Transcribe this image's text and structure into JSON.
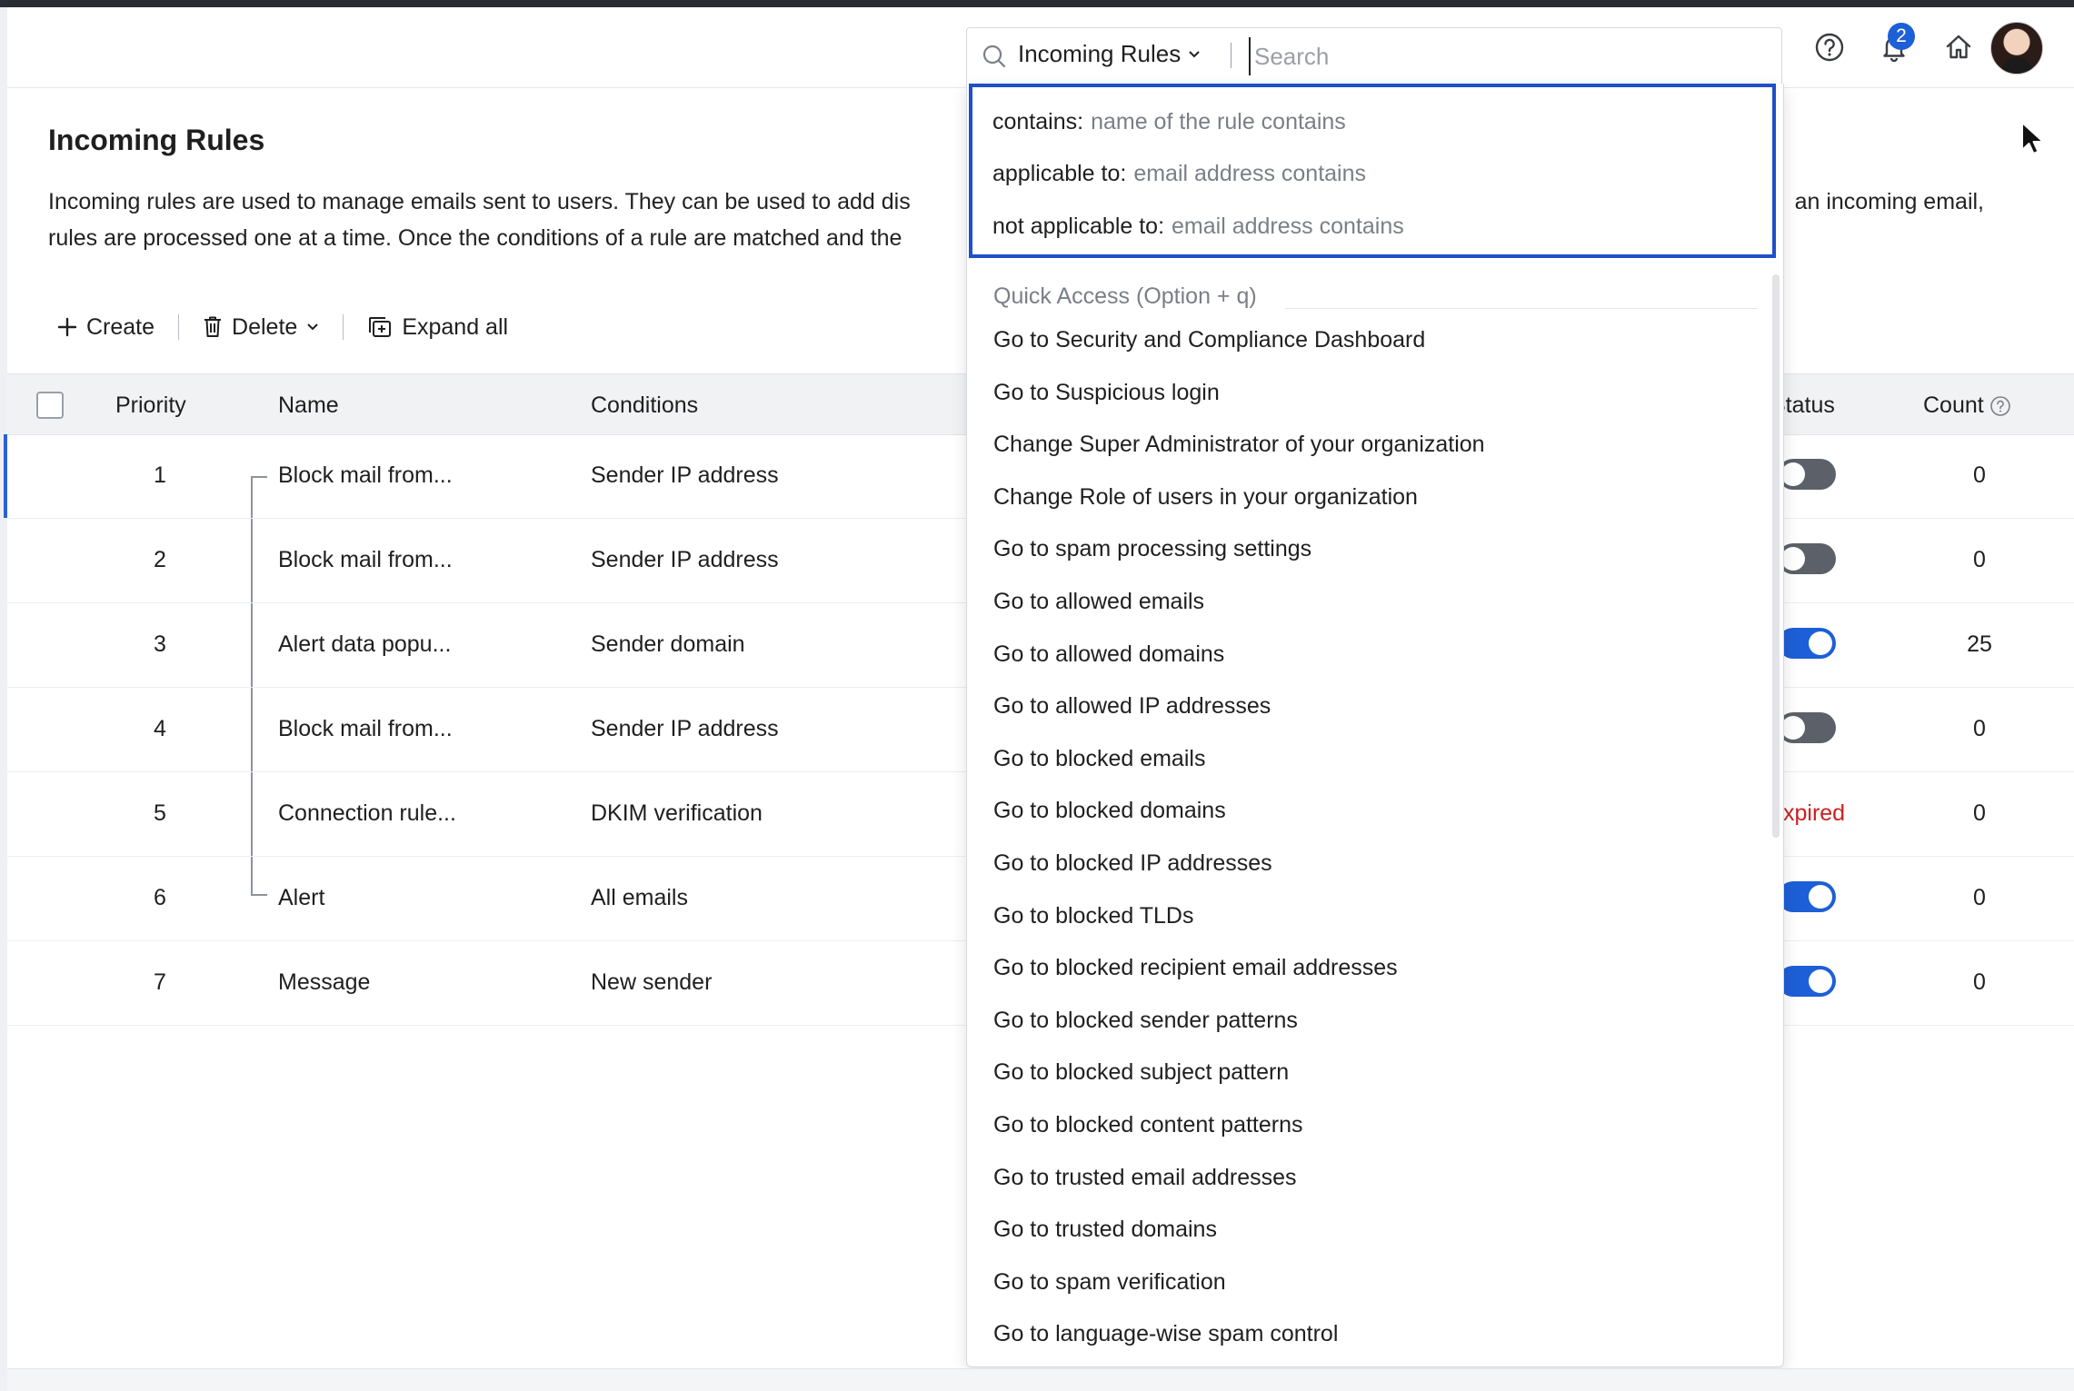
{
  "page": {
    "title": "Incoming Rules",
    "description": "Incoming rules are used to manage emails sent to users. They can be used to add dis… an incoming email, rules are processed one at a time. Once the conditions of a rule are matched and the…",
    "desc_line1_left": "Incoming rules are used to manage emails sent to users. They can be used to add dis",
    "desc_line1_right": "an incoming email,",
    "desc_line2_left": "rules are processed one at a time. Once the conditions of a rule are matched and the"
  },
  "toolbar": {
    "create_label": "Create",
    "delete_label": "Delete",
    "expand_label": "Expand all"
  },
  "table": {
    "columns": {
      "priority": "Priority",
      "name": "Name",
      "conditions": "Conditions",
      "status": "Status",
      "count": "Count"
    },
    "rows": [
      {
        "priority": "1",
        "name": "Block mail from...",
        "condition": "Sender IP address",
        "status": "off",
        "status_text": "",
        "count": "0"
      },
      {
        "priority": "2",
        "name": "Block mail from...",
        "condition": "Sender IP address",
        "status": "off",
        "status_text": "",
        "count": "0"
      },
      {
        "priority": "3",
        "name": "Alert data popu...",
        "condition": "Sender domain",
        "status": "on",
        "status_text": "",
        "count": "25"
      },
      {
        "priority": "4",
        "name": "Block mail from...",
        "condition": "Sender IP address",
        "status": "off",
        "status_text": "",
        "count": "0"
      },
      {
        "priority": "5",
        "name": "Connection rule...",
        "condition": "DKIM verification",
        "status": "expired",
        "status_text": "xpired",
        "count": "0"
      },
      {
        "priority": "6",
        "name": "Alert",
        "condition": "All emails",
        "status": "on",
        "status_text": "",
        "count": "0"
      },
      {
        "priority": "7",
        "name": "Message",
        "condition": "New sender",
        "status": "on",
        "status_text": "",
        "count": "0"
      }
    ]
  },
  "header": {
    "notification_count": "2"
  },
  "search": {
    "scope": "Incoming Rules",
    "placeholder": "Search",
    "filters": [
      {
        "key": "contains:",
        "hint": "name of the rule contains"
      },
      {
        "key": "applicable to:",
        "hint": "email address contains"
      },
      {
        "key": "not applicable to:",
        "hint": "email address contains"
      }
    ],
    "quick_access_label": "Quick Access (Option + q)",
    "quick_access": [
      "Go to Security and Compliance Dashboard",
      "Go to Suspicious login",
      "Change Super Administrator of your organization",
      "Change Role of users in your organization",
      "Go to spam processing settings",
      "Go to allowed emails",
      "Go to allowed domains",
      "Go to allowed IP addresses",
      "Go to blocked emails",
      "Go to blocked domains",
      "Go to blocked IP addresses",
      "Go to blocked TLDs",
      "Go to blocked recipient email addresses",
      "Go to blocked sender patterns",
      "Go to blocked subject pattern",
      "Go to blocked content patterns",
      "Go to trusted email addresses",
      "Go to trusted domains",
      "Go to spam verification",
      "Go to language-wise spam control"
    ]
  },
  "colors": {
    "accent": "#1d5fd6",
    "focus_border": "#1f4fc9",
    "expired": "#cc1f1f",
    "toggle_off": "#5c6068"
  }
}
